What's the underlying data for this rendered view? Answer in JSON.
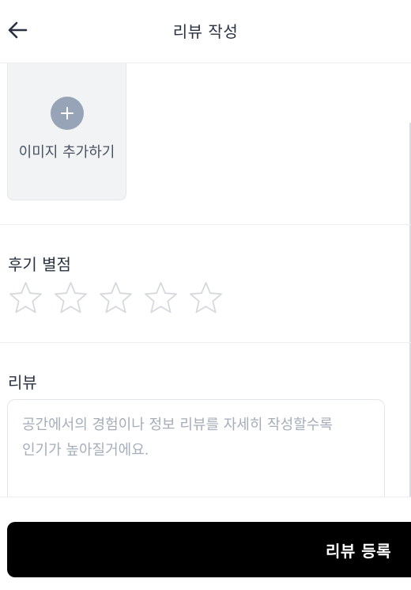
{
  "header": {
    "title": "리뷰 작성",
    "back_icon": "arrow-left-icon"
  },
  "image_upload": {
    "label": "이미지 추가하기",
    "icon": "plus-icon"
  },
  "rating": {
    "title": "후기 별점",
    "max_stars": 5,
    "value": 0
  },
  "review": {
    "title": "리뷰",
    "value": "",
    "placeholder": "공간에서의 경험이나 정보 리뷰를 자세히 작성할수록\n인기가 높아질거에요."
  },
  "submit": {
    "label": "리뷰 등록"
  },
  "colors": {
    "accent_button": "#000000",
    "plus_circle": "#97a3b6",
    "star_outline": "#d4d7dc"
  }
}
